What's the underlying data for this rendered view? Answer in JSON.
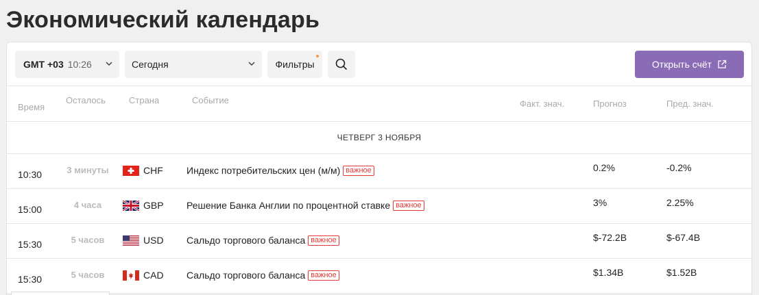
{
  "page": {
    "title": "Экономический календарь"
  },
  "toolbar": {
    "timezone": "GMT +03",
    "time": "10:26",
    "period": "Сегодня",
    "filters": "Фильтры",
    "open_account": "Открыть счёт"
  },
  "columns": {
    "time": "Время",
    "left": "Осталось",
    "country": "Страна",
    "event": "Событие",
    "actual": "Факт. знач.",
    "forecast": "Прогноз",
    "previous": "Пред. знач."
  },
  "day": "ЧЕТВЕРГ 3 НОЯБРЯ",
  "events": [
    {
      "time": "10:30",
      "left": "3 минуты",
      "country": "CHF",
      "event": "Индекс потребительских цен (м/м)",
      "badge": "важное",
      "forecast": "0.2%",
      "previous": "-0.2%"
    },
    {
      "time": "15:00",
      "left": "4 часа",
      "country": "GBP",
      "event": "Решение Банка Англии по процентной ставке",
      "badge": "важное",
      "forecast": "3%",
      "previous": "2.25%"
    },
    {
      "time": "15:30",
      "left": "5 часов",
      "country": "USD",
      "event": "Сальдо торгового баланса",
      "badge": "важное",
      "forecast": "$-72.2B",
      "previous": "$-67.4B"
    },
    {
      "time": "15:30",
      "left": "5 часов",
      "country": "CAD",
      "event": "Сальдо торгового баланса",
      "badge": "важное",
      "forecast": "$1.34B",
      "previous": "$1.52B"
    }
  ],
  "colors": {
    "accent": "#8a6bb5",
    "important": "#e53935",
    "filter_dot": "#f39a4c"
  }
}
